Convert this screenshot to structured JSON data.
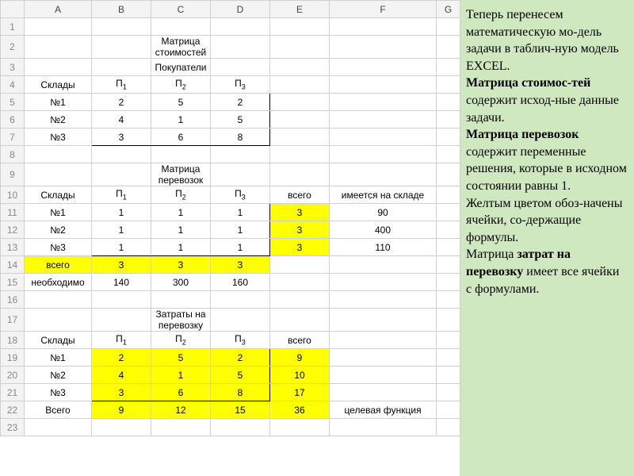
{
  "columns": [
    "A",
    "B",
    "C",
    "D",
    "E",
    "F",
    "G"
  ],
  "rows": 23,
  "titles": {
    "cost_matrix": "Матрица стоимостей",
    "buyers": "Покупатели",
    "transport_matrix": "Матрица перевозок",
    "cost_title": "Затраты на перевозку"
  },
  "labels": {
    "warehouses": "Склады",
    "p1": "П",
    "p1s": "1",
    "p2": "П",
    "p2s": "2",
    "p3": "П",
    "p3s": "3",
    "n1": "№1",
    "n2": "№2",
    "n3": "№3",
    "total": "всего",
    "total_cap": "Всего",
    "in_stock": "имеется на складе",
    "needed": "необходимо",
    "objective": "целевая функция"
  },
  "cost_matrix": {
    "rows": [
      [
        2,
        5,
        2
      ],
      [
        4,
        1,
        5
      ],
      [
        3,
        6,
        8
      ]
    ]
  },
  "transport_matrix": {
    "rows": [
      [
        1,
        1,
        1
      ],
      [
        1,
        1,
        1
      ],
      [
        1,
        1,
        1
      ]
    ],
    "row_totals": [
      3,
      3,
      3
    ],
    "stock": [
      90,
      400,
      110
    ],
    "col_totals": [
      3,
      3,
      3
    ],
    "needed": [
      140,
      300,
      160
    ]
  },
  "expense_matrix": {
    "rows": [
      [
        2,
        5,
        2
      ],
      [
        4,
        1,
        5
      ],
      [
        3,
        6,
        8
      ]
    ],
    "row_totals": [
      9,
      10,
      17
    ],
    "col_totals": [
      9,
      12,
      15
    ],
    "grand_total": 36
  },
  "explain": {
    "p1": "Теперь перенесем математическую мо-дель задачи в таблич-ную модель EXCEL.",
    "p2a": "Матрица стоимос-тей",
    "p2b": " содержит исход-ные данные задачи.",
    "p3a": "Матрица перевозок",
    "p3b": " содержит переменные решения, которые в исходном состоянии равны 1.",
    "p4": "Желтым цветом обоз-начены ячейки, со-держащие формулы.",
    "p5a": "Матрица ",
    "p5b": "затрат на перевозку",
    "p5c": " имеет все ячейки с формулами."
  }
}
